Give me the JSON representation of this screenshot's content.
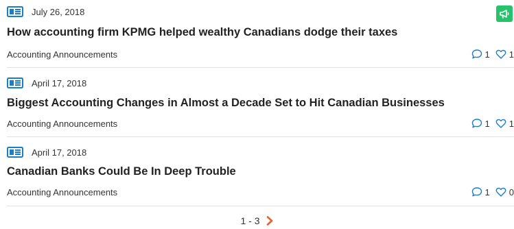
{
  "items": [
    {
      "date": "July 26, 2018",
      "title": "How accounting firm KPMG helped wealthy Canadians dodge their taxes",
      "category": "Accounting Announcements",
      "comments": "1",
      "likes": "1",
      "announcement": true
    },
    {
      "date": "April 17, 2018",
      "title": "Biggest Accounting Changes in Almost a Decade Set to Hit Canadian Businesses",
      "category": "Accounting Announcements",
      "comments": "1",
      "likes": "1",
      "announcement": false
    },
    {
      "date": "April 17, 2018",
      "title": "Canadian Banks Could Be In Deep Trouble",
      "category": "Accounting Announcements",
      "comments": "1",
      "likes": "0",
      "announcement": false
    }
  ],
  "pagination": {
    "range": "1 - 3"
  },
  "colors": {
    "accent": "#1a7fc6",
    "announce": "#27c26c",
    "next_arrow": "#e8602c"
  },
  "icons": {
    "item": "newspaper-icon",
    "comments": "comment-icon",
    "likes": "heart-icon",
    "announce": "megaphone-icon",
    "next": "chevron-right-icon"
  }
}
